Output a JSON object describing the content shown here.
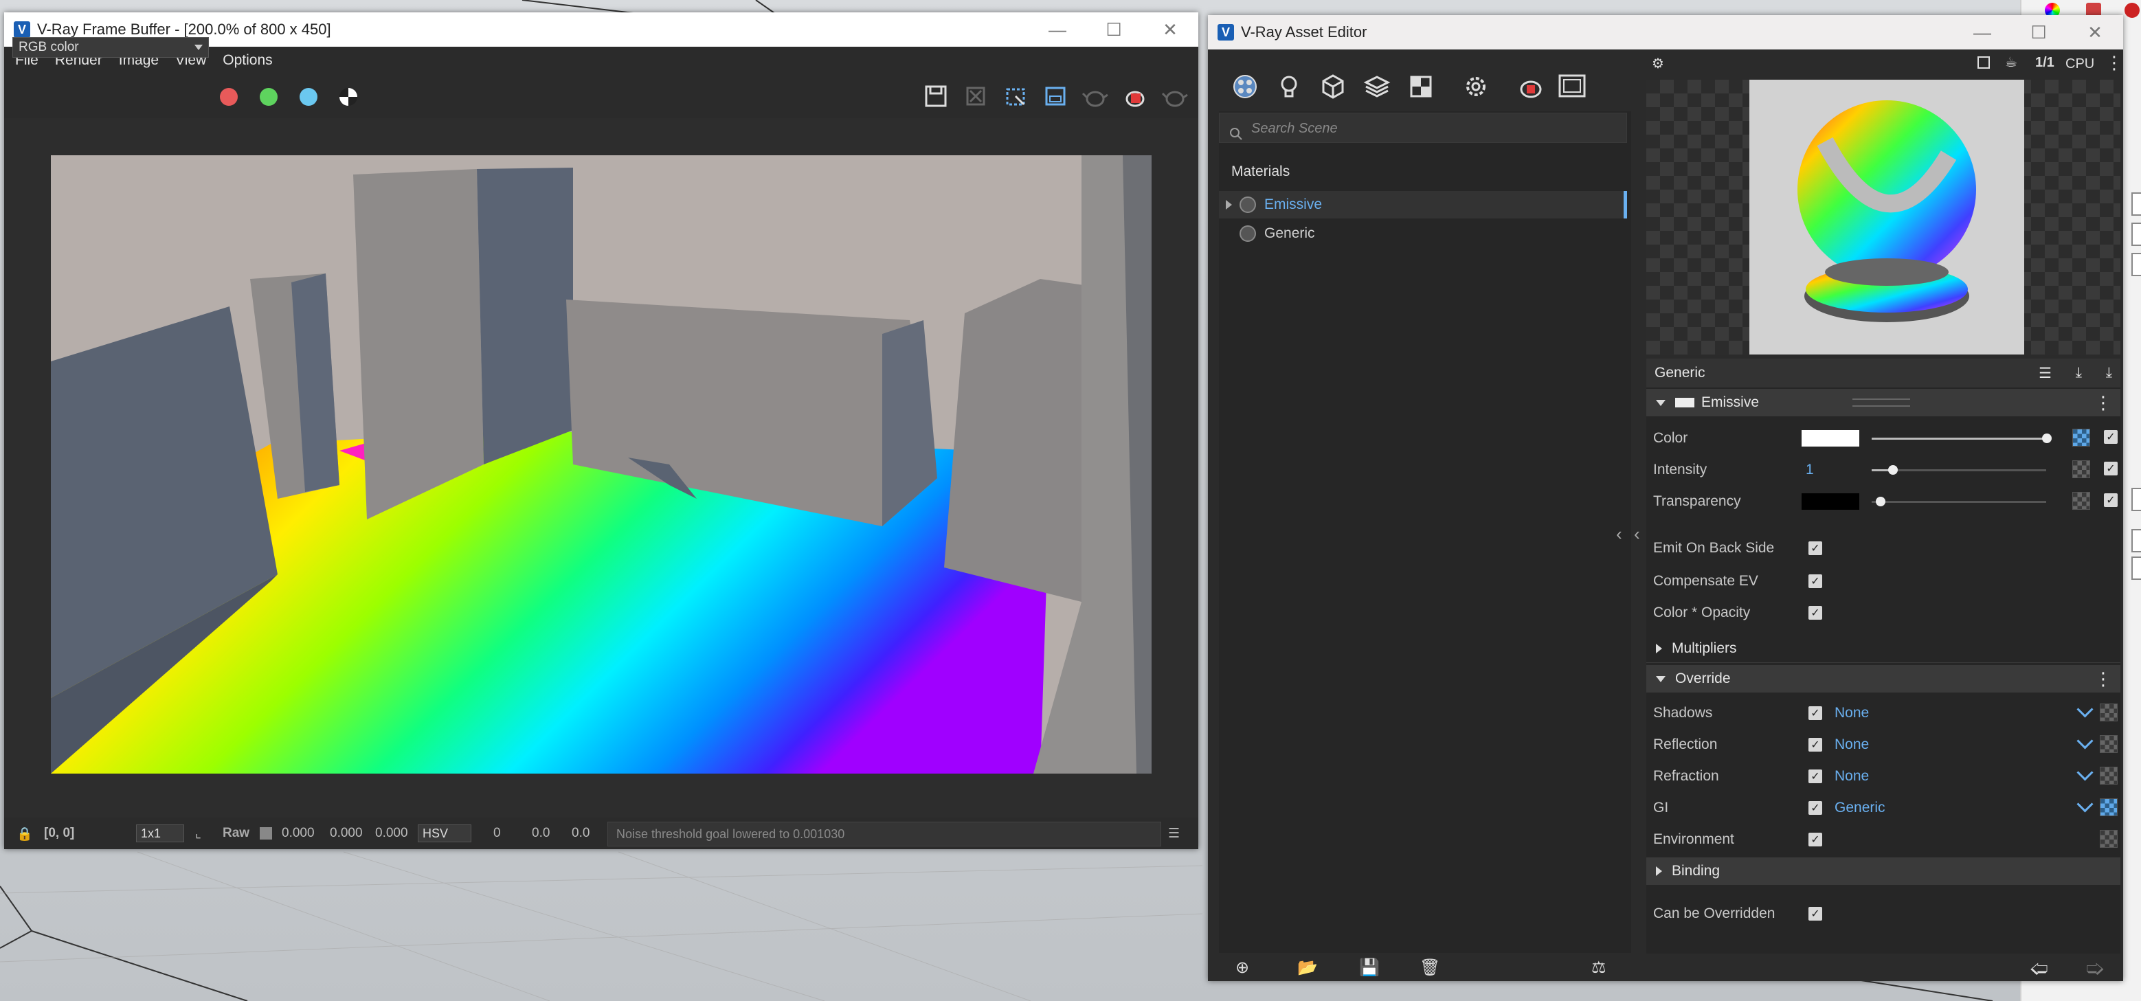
{
  "frame_buffer": {
    "title": "V-Ray Frame Buffer - [200.0% of 800 x 450]",
    "menu": [
      "File",
      "Render",
      "Image",
      "View",
      "Options"
    ],
    "channel": "RGB color",
    "channel_colors": {
      "red": "#e85a5a",
      "green": "#5ed35e",
      "blue": "#6bc8f0"
    },
    "status": {
      "coords": "[0, 0]",
      "zoom": "1x1",
      "raw_label": "Raw",
      "rgb": [
        "0.000",
        "0.000",
        "0.000"
      ],
      "color_mode": "HSV",
      "hsv": [
        "0",
        "0.0",
        "0.0"
      ],
      "message": "Noise threshold goal lowered to 0.001030"
    }
  },
  "asset_editor": {
    "title": "V-Ray Asset Editor",
    "search_placeholder": "Search Scene",
    "materials_header": "Materials",
    "materials": [
      {
        "name": "Emissive",
        "selected": true
      },
      {
        "name": "Generic",
        "selected": false
      }
    ],
    "preview": {
      "ratio": "1/1",
      "engine": "CPU"
    },
    "panel_title": "Generic",
    "emissive_section": "Emissive",
    "props": {
      "color_label": "Color",
      "intensity_label": "Intensity",
      "intensity_value": "1",
      "transparency_label": "Transparency",
      "emit_back": "Emit On Back Side",
      "compensate_ev": "Compensate EV",
      "color_opacity": "Color * Opacity"
    },
    "multipliers_section": "Multipliers",
    "override_section": "Override",
    "override": {
      "shadows_label": "Shadows",
      "shadows_value": "None",
      "reflection_label": "Reflection",
      "reflection_value": "None",
      "refraction_label": "Refraction",
      "refraction_value": "None",
      "gi_label": "GI",
      "gi_value": "Generic",
      "environment_label": "Environment"
    },
    "binding_section": "Binding",
    "can_be_overridden": "Can be Overridden"
  }
}
